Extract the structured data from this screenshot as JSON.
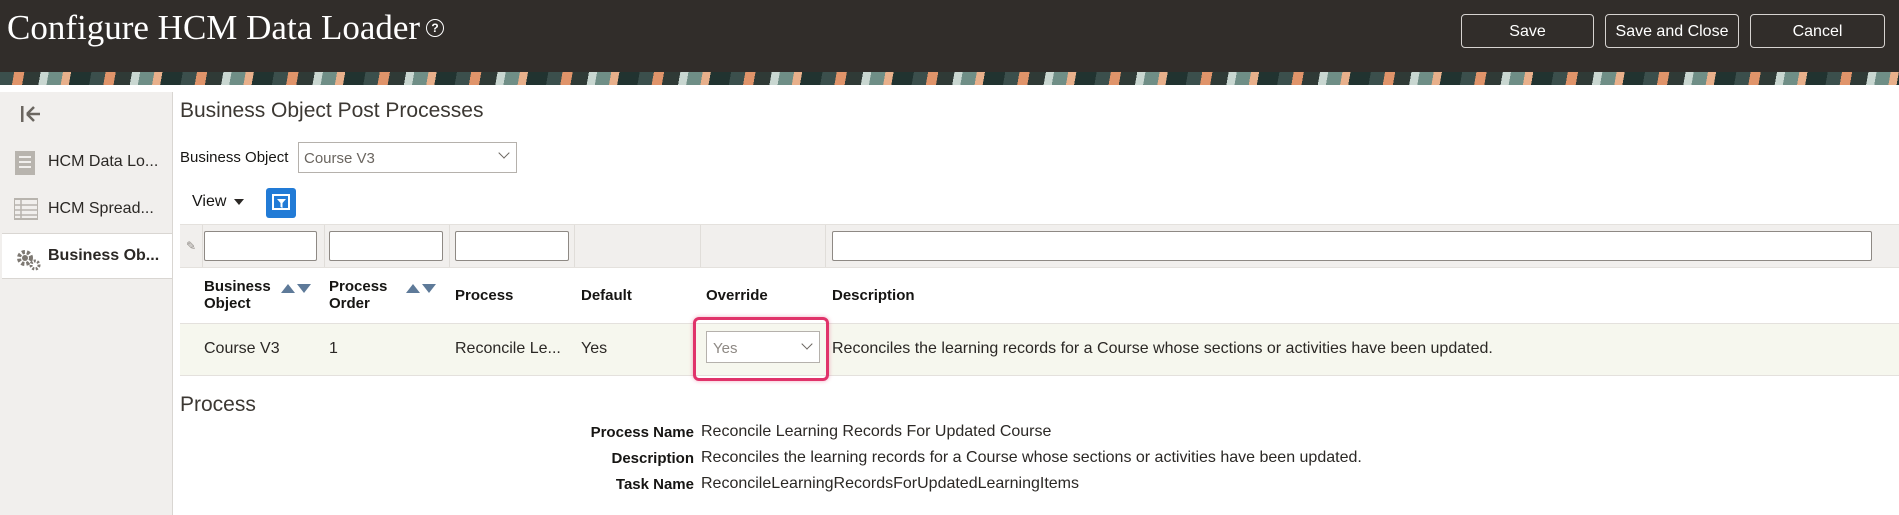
{
  "header": {
    "title": "Configure HCM Data Loader",
    "help_icon": "?",
    "buttons": {
      "save": "Save",
      "save_and_close": "Save and Close",
      "cancel": "Cancel"
    }
  },
  "sidebar": {
    "collapse_icon": "collapse-left-icon",
    "items": [
      {
        "label": "HCM Data Lo...",
        "icon": "document-icon",
        "active": false
      },
      {
        "label": "HCM Spread...",
        "icon": "spreadsheet-icon",
        "active": false
      },
      {
        "label": "Business Ob...",
        "icon": "gear-icon",
        "active": true
      }
    ]
  },
  "main": {
    "section_title": "Business Object Post Processes",
    "business_object_label": "Business Object",
    "business_object_value": "Course V3",
    "view_menu": "View",
    "table": {
      "columns": [
        {
          "line1": "Business",
          "line2": "Object"
        },
        {
          "line1": "Process",
          "line2": "Order"
        },
        {
          "line1": "Process",
          "line2": ""
        },
        {
          "line1": "Default",
          "line2": ""
        },
        {
          "line1": "Override",
          "line2": ""
        },
        {
          "line1": "Description",
          "line2": ""
        }
      ],
      "rows": [
        {
          "business_object": "Course V3",
          "process_order": "1",
          "process": "Reconcile Le...",
          "default": "Yes",
          "override": "Yes",
          "description": "Reconciles the learning records for a Course whose sections or activities have been updated."
        }
      ]
    }
  },
  "process": {
    "title": "Process",
    "fields": [
      {
        "label": "Process Name",
        "value": "Reconcile Learning Records For Updated Course"
      },
      {
        "label": "Description",
        "value": "Reconciles the learning records for a Course whose sections or activities have been updated."
      },
      {
        "label": "Task Name",
        "value": "ReconcileLearningRecordsForUpdatedLearningItems"
      }
    ]
  },
  "colors": {
    "header_bg": "#312d2a",
    "accent_blue": "#227bd6",
    "highlight": "#e0336a",
    "row_bg": "#f6f7ee"
  }
}
